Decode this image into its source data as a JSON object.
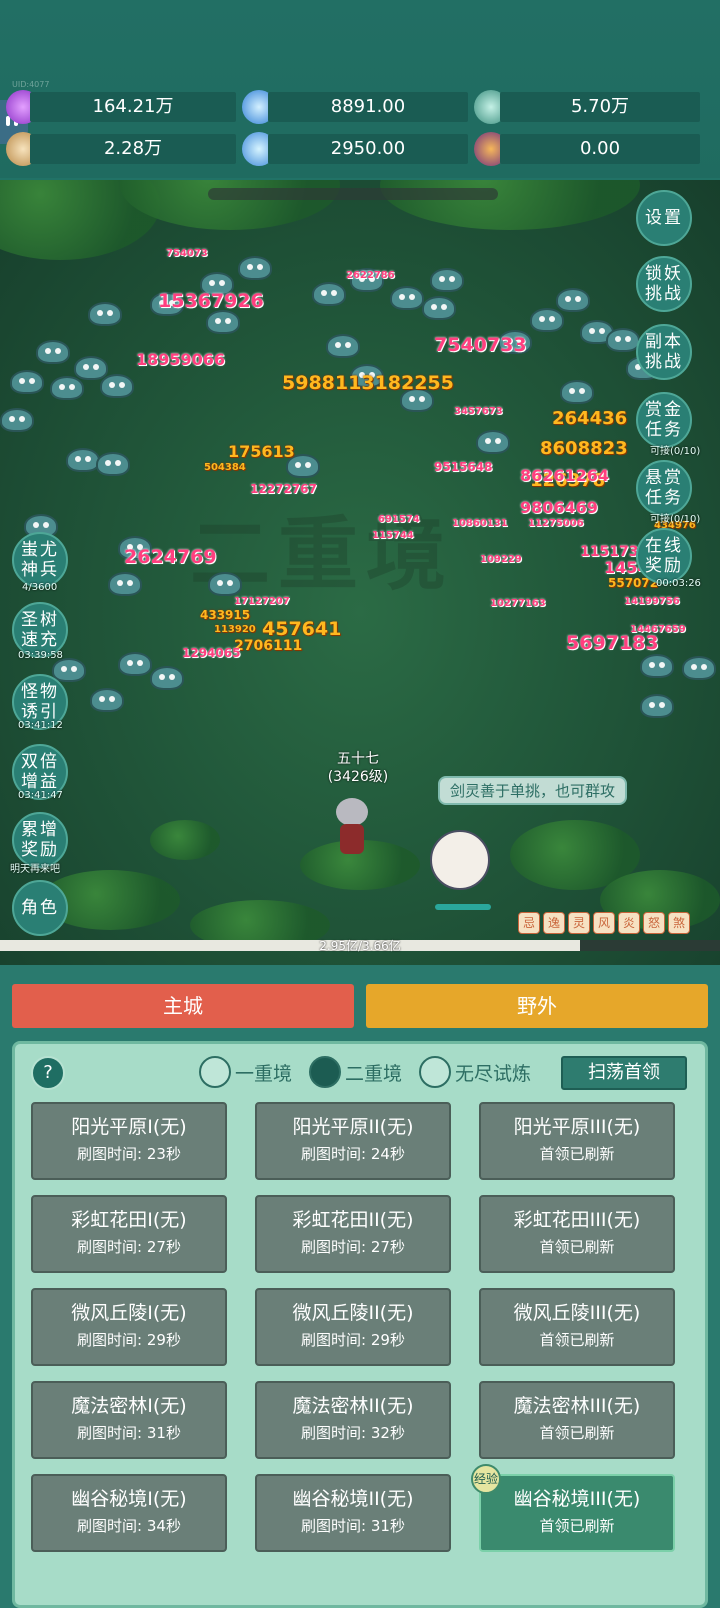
{
  "top": {
    "player_id": "UID:4077",
    "resources": [
      {
        "icon": "purple-gem-icon",
        "value": "164.21万"
      },
      {
        "icon": "blue-crystal-icon",
        "value": "8891.00"
      },
      {
        "icon": "teal-orb-icon",
        "value": "5.70万"
      },
      {
        "icon": "scroll-icon",
        "value": "2.28万"
      },
      {
        "icon": "ice-shard-icon",
        "value": "2950.00"
      },
      {
        "icon": "purple-pot-icon",
        "value": "0.00"
      }
    ]
  },
  "right_menu": [
    {
      "label": "设置"
    },
    {
      "label": "锁妖挑战"
    },
    {
      "label": "副本挑战"
    },
    {
      "label": "赏金任务",
      "sub": "可接(0/10)"
    },
    {
      "label": "悬赏任务",
      "sub": "可接(0/10)"
    },
    {
      "label": "在线奖励",
      "sub": "00:03:26"
    }
  ],
  "left_menu": [
    {
      "label": "蚩尤神兵",
      "sub": "4/3600"
    },
    {
      "label": "圣树速充",
      "sub": "03:39:58"
    },
    {
      "label": "怪物诱引",
      "sub": "03:41:12"
    },
    {
      "label": "双倍增益",
      "sub": "03:41:47"
    },
    {
      "label": "累增奖励",
      "sub": "明天再来吧"
    },
    {
      "label": "角色"
    }
  ],
  "battle": {
    "hero_name": "五十七",
    "hero_level": "(3426级)",
    "speech": "剑灵善于单挑，也可群攻",
    "xp_text": "2.95亿/3.66亿",
    "xp_fraction": 0.806,
    "damage_numbers": [
      "754073",
      "15367926",
      "2622786",
      "18959066",
      "7540733",
      "5988113182255",
      "264436",
      "3457673",
      "8608823",
      "9515648",
      "126378",
      "86261264",
      "9806469",
      "175613",
      "504384",
      "12272767",
      "2624769",
      "457641",
      "2706111",
      "5697183",
      "433915",
      "113920",
      "17127207",
      "691574",
      "115744",
      "115173880",
      "14546",
      "557072",
      "434976",
      "1294065",
      "11275006",
      "10860131",
      "109229",
      "10277163",
      "14199756",
      "14467659"
    ],
    "skill_orbs": [
      "忌",
      "逸",
      "灵",
      "风",
      "炎",
      "怒",
      "煞"
    ]
  },
  "tabs": {
    "main_city": "主城",
    "wild": "野外"
  },
  "realm": {
    "help": "?",
    "options": [
      {
        "label": "一重境",
        "selected": false
      },
      {
        "label": "二重境",
        "selected": true
      },
      {
        "label": "无尽试炼",
        "selected": false
      }
    ],
    "sweep_button": "扫荡首领"
  },
  "stages": [
    {
      "name": "阳光平原I(无)",
      "info": "刷图时间: 23秒"
    },
    {
      "name": "阳光平原II(无)",
      "info": "刷图时间: 24秒"
    },
    {
      "name": "阳光平原III(无)",
      "info": "首领已刷新"
    },
    {
      "name": "彩虹花田I(无)",
      "info": "刷图时间: 27秒"
    },
    {
      "name": "彩虹花田II(无)",
      "info": "刷图时间: 27秒"
    },
    {
      "name": "彩虹花田III(无)",
      "info": "首领已刷新"
    },
    {
      "name": "微风丘陵I(无)",
      "info": "刷图时间: 29秒"
    },
    {
      "name": "微风丘陵II(无)",
      "info": "刷图时间: 29秒"
    },
    {
      "name": "微风丘陵III(无)",
      "info": "首领已刷新"
    },
    {
      "name": "魔法密林I(无)",
      "info": "刷图时间: 31秒"
    },
    {
      "name": "魔法密林II(无)",
      "info": "刷图时间: 32秒"
    },
    {
      "name": "魔法密林III(无)",
      "info": "首领已刷新"
    },
    {
      "name": "幽谷秘境I(无)",
      "info": "刷图时间: 34秒"
    },
    {
      "name": "幽谷秘境II(无)",
      "info": "刷图时间: 31秒"
    },
    {
      "name": "幽谷秘境III(无)",
      "info": "首领已刷新",
      "badge": "经验"
    }
  ]
}
